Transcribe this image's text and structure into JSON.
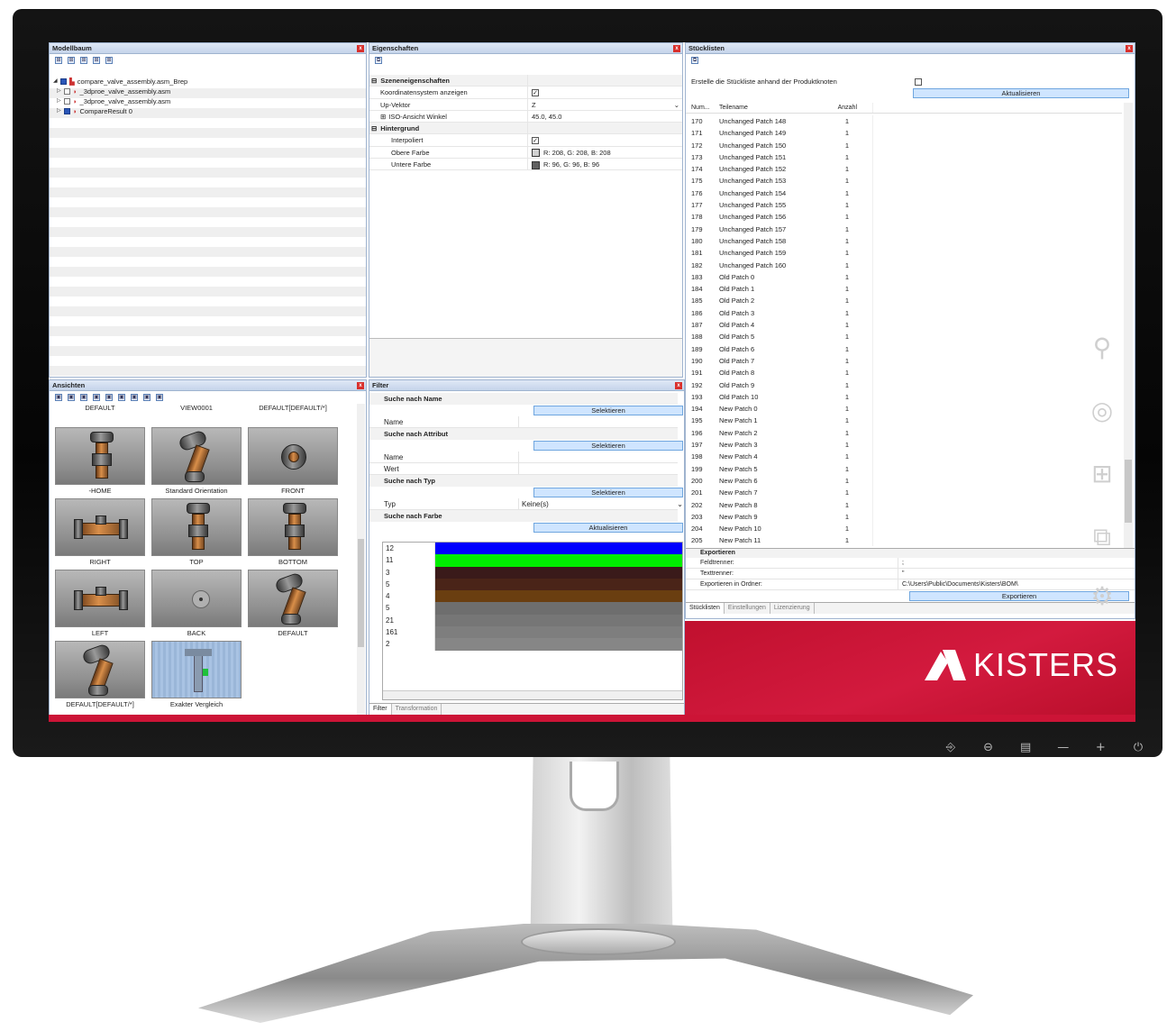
{
  "model_tree": {
    "title": "Modellbaum",
    "toolbar_icons": [
      "expand-all-icon",
      "collapse-all-icon",
      "expand-icon",
      "collapse-icon",
      "select-icon"
    ],
    "nodes": [
      {
        "label": "compare_valve_assembly.asm_Brep",
        "checked": true
      },
      {
        "label": "_3dproe_valve_assembly.asm",
        "checked": false
      },
      {
        "label": "_3dproe_valve_assembly.asm",
        "checked": false
      },
      {
        "label": "CompareResult 0",
        "checked": true
      }
    ]
  },
  "properties": {
    "title": "Eigenschaften",
    "rows": [
      {
        "name": "Szeneneigenschaften",
        "value": "",
        "type": "category"
      },
      {
        "name": "Koordinatensystem anzeigen",
        "value": "✓",
        "type": "check"
      },
      {
        "name": "Up-Vektor",
        "value": "Z",
        "type": "dropdown"
      },
      {
        "name": "ISO-Ansicht Winkel",
        "value": "45.0, 45.0",
        "type": "expandable"
      },
      {
        "name": "Hintergrund",
        "value": "",
        "type": "category"
      },
      {
        "name": "Interpoliert",
        "value": "✓",
        "type": "check"
      },
      {
        "name": "Obere Farbe",
        "value": "R: 208, G: 208, B: 208",
        "type": "color",
        "color": "#d0d0d0"
      },
      {
        "name": "Untere Farbe",
        "value": "R: 96, G: 96, B: 96",
        "type": "color",
        "color": "#606060"
      }
    ]
  },
  "views": {
    "title": "Ansichten",
    "top_labels": [
      "DEFAULT",
      "VIEW0001",
      "DEFAULT[DEFAULT/*]"
    ],
    "items": [
      "-HOME",
      "Standard Orientation",
      "FRONT",
      "RIGHT",
      "TOP",
      "BOTTOM",
      "LEFT",
      "BACK",
      "DEFAULT",
      "DEFAULT[DEFAULT/*]",
      "Exakter Vergleich"
    ]
  },
  "filter": {
    "title": "Filter",
    "by_name": {
      "label": "Suche nach Name",
      "button": "Selektieren",
      "field": "Name"
    },
    "by_attribute": {
      "label": "Suche nach Attribut",
      "button": "Selektieren",
      "field1": "Name",
      "field2": "Wert"
    },
    "by_type": {
      "label": "Suche nach Typ",
      "button": "Selektieren",
      "field": "Typ",
      "value": "Keine(s)"
    },
    "by_color": {
      "label": "Suche nach Farbe",
      "button": "Aktualisieren"
    },
    "colors": [
      {
        "count": "12",
        "color": "#0000ff"
      },
      {
        "count": "11",
        "color": "#00ee00"
      },
      {
        "count": "3",
        "color": "#3a1a1a"
      },
      {
        "count": "5",
        "color": "#4a2418"
      },
      {
        "count": "4",
        "color": "#6a3e10"
      },
      {
        "count": "5",
        "color": "#6e6e6e"
      },
      {
        "count": "21",
        "color": "#767676"
      },
      {
        "count": "161",
        "color": "#7e7e7e"
      },
      {
        "count": "2",
        "color": "#868686"
      }
    ],
    "tabs": [
      "Filter",
      "Transformation"
    ]
  },
  "bom": {
    "title": "Stücklisten",
    "create_label": "Erstelle die Stückliste anhand der Produktknoten",
    "refresh_button": "Aktualisieren",
    "columns": [
      "Num...",
      "Teilename",
      "Anzahl"
    ],
    "rows": [
      [
        "170",
        "Unchanged Patch 148",
        "1"
      ],
      [
        "171",
        "Unchanged Patch 149",
        "1"
      ],
      [
        "172",
        "Unchanged Patch 150",
        "1"
      ],
      [
        "173",
        "Unchanged Patch 151",
        "1"
      ],
      [
        "174",
        "Unchanged Patch 152",
        "1"
      ],
      [
        "175",
        "Unchanged Patch 153",
        "1"
      ],
      [
        "176",
        "Unchanged Patch 154",
        "1"
      ],
      [
        "177",
        "Unchanged Patch 155",
        "1"
      ],
      [
        "178",
        "Unchanged Patch 156",
        "1"
      ],
      [
        "179",
        "Unchanged Patch 157",
        "1"
      ],
      [
        "180",
        "Unchanged Patch 158",
        "1"
      ],
      [
        "181",
        "Unchanged Patch 159",
        "1"
      ],
      [
        "182",
        "Unchanged Patch 160",
        "1"
      ],
      [
        "183",
        "Old Patch 0",
        "1"
      ],
      [
        "184",
        "Old Patch 1",
        "1"
      ],
      [
        "185",
        "Old Patch 2",
        "1"
      ],
      [
        "186",
        "Old Patch 3",
        "1"
      ],
      [
        "187",
        "Old Patch 4",
        "1"
      ],
      [
        "188",
        "Old Patch 5",
        "1"
      ],
      [
        "189",
        "Old Patch 6",
        "1"
      ],
      [
        "190",
        "Old Patch 7",
        "1"
      ],
      [
        "191",
        "Old Patch 8",
        "1"
      ],
      [
        "192",
        "Old Patch 9",
        "1"
      ],
      [
        "193",
        "Old Patch 10",
        "1"
      ],
      [
        "194",
        "New Patch 0",
        "1"
      ],
      [
        "195",
        "New Patch 1",
        "1"
      ],
      [
        "196",
        "New Patch 2",
        "1"
      ],
      [
        "197",
        "New Patch 3",
        "1"
      ],
      [
        "198",
        "New Patch 4",
        "1"
      ],
      [
        "199",
        "New Patch 5",
        "1"
      ],
      [
        "200",
        "New Patch 6",
        "1"
      ],
      [
        "201",
        "New Patch 7",
        "1"
      ],
      [
        "202",
        "New Patch 8",
        "1"
      ],
      [
        "203",
        "New Patch 9",
        "1"
      ],
      [
        "204",
        "New Patch 10",
        "1"
      ],
      [
        "205",
        "New Patch 11",
        "1"
      ]
    ],
    "export": {
      "label": "Exportieren",
      "field_sep_label": "Feldtrenner:",
      "field_sep_value": ";",
      "text_sep_label": "Texttrenner:",
      "text_sep_value": "\"",
      "folder_label": "Exportieren in Ordner:",
      "folder_value": "C:\\Users\\Public\\Documents\\Kisters\\BOM\\",
      "button": "Exportieren"
    },
    "tabs": [
      "Stücklisten",
      "Einstellungen",
      "Lizenzierung"
    ]
  },
  "brand": {
    "name": "KISTERS",
    "color": "#cc1436"
  },
  "monitor_buttons": [
    "input-icon",
    "menu-icon",
    "settings-icon",
    "minus-icon",
    "plus-icon",
    "power-icon"
  ],
  "monitor_glyphs": [
    "⎆",
    "⊖",
    "▤",
    "—",
    "+",
    "⏻"
  ],
  "side_icons": [
    "search-icon",
    "chrome-icon",
    "windows-icon",
    "devices-icon",
    "gear-icon"
  ]
}
